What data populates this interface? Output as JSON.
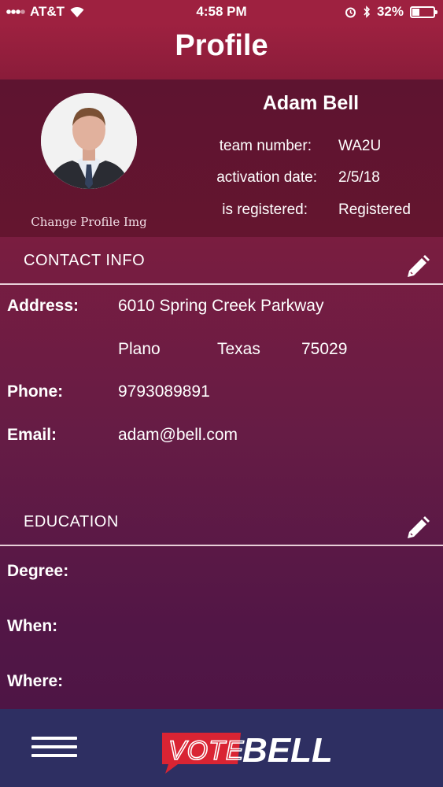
{
  "status_bar": {
    "carrier": "AT&T",
    "time": "4:58 PM",
    "battery": "32%"
  },
  "header": {
    "title": "Profile"
  },
  "profile": {
    "name": "Adam Bell",
    "change_image_label": "Change Profile Img",
    "fields": [
      {
        "label": "team number:",
        "value": "WA2U"
      },
      {
        "label": "activation date:",
        "value": "2/5/18"
      },
      {
        "label": "is registered:",
        "value": "Registered"
      }
    ]
  },
  "contact_info": {
    "title": "CONTACT INFO",
    "address_label": "Address:",
    "address_line1": "6010 Spring Creek Parkway",
    "city": "Plano",
    "state": "Texas",
    "zip": "75029",
    "phone_label": "Phone:",
    "phone": "9793089891",
    "email_label": "Email:",
    "email": "adam@bell.com"
  },
  "education": {
    "title": "EDUCATION",
    "degree_label": "Degree:",
    "when_label": "When:",
    "where_label": "Where:"
  },
  "bottom_bar": {
    "logo_text_vote": "VOTE",
    "logo_text_bell": "BELL",
    "brand_red": "#d92433",
    "bar_color": "#2e2f62"
  }
}
